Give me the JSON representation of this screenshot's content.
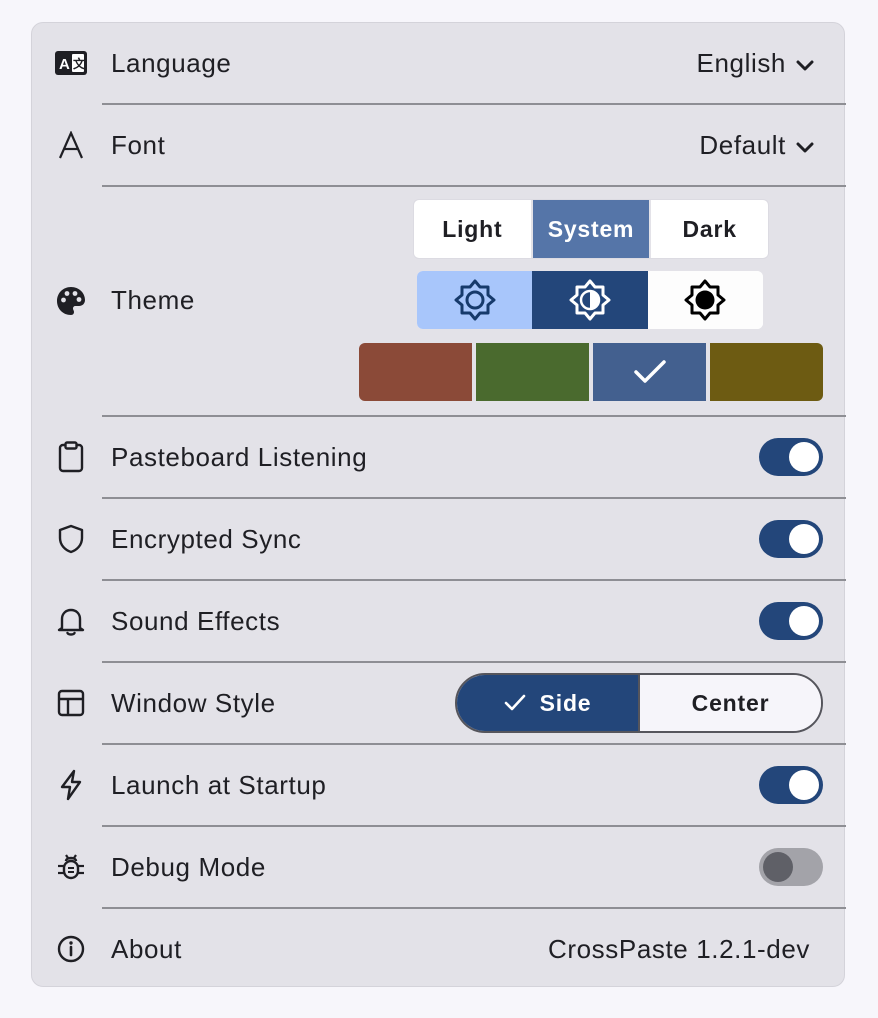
{
  "settings": {
    "language": {
      "label": "Language",
      "value": "English"
    },
    "font": {
      "label": "Font",
      "value": "Default"
    },
    "theme": {
      "label": "Theme",
      "modes": [
        "Light",
        "System",
        "Dark"
      ],
      "selected_mode": "System",
      "color_swatches": [
        "#8b4a38",
        "#4a6a2e",
        "#43608f",
        "#6d5b12"
      ],
      "selected_swatch_index": 2
    },
    "pasteboard_listening": {
      "label": "Pasteboard Listening",
      "enabled": true
    },
    "encrypted_sync": {
      "label": "Encrypted Sync",
      "enabled": true
    },
    "sound_effects": {
      "label": "Sound Effects",
      "enabled": true
    },
    "window_style": {
      "label": "Window Style",
      "options": [
        "Side",
        "Center"
      ],
      "selected": "Side"
    },
    "launch_at_startup": {
      "label": "Launch at Startup",
      "enabled": true
    },
    "debug_mode": {
      "label": "Debug Mode",
      "enabled": false
    },
    "about": {
      "label": "About",
      "value": "CrossPaste 1.2.1-dev"
    }
  },
  "colors": {
    "accent": "#23467a",
    "accent_light": "#5575a8",
    "panel_bg": "#e3e2e8"
  }
}
